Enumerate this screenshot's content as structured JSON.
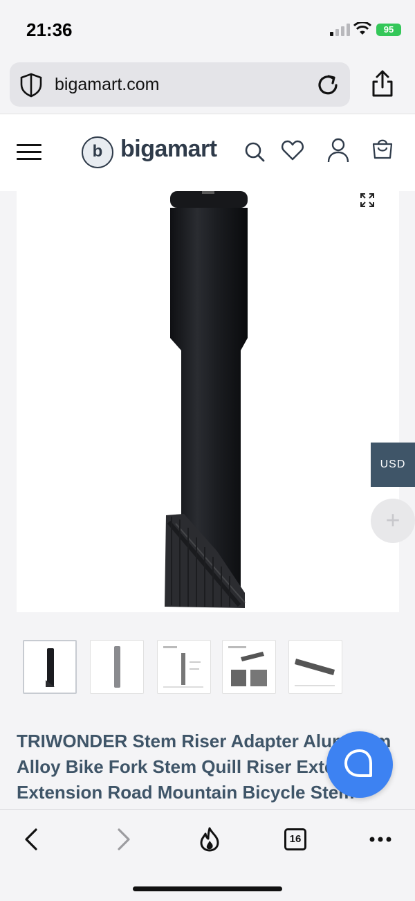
{
  "status_bar": {
    "time": "21:36",
    "battery": "95"
  },
  "browser": {
    "url": "bigamart.com",
    "tab_count": "16"
  },
  "site": {
    "logo_glyph": "b",
    "logo_text": "bigamart",
    "currency": "USD"
  },
  "product": {
    "title_lines": [
      "TRIWONDER Stem Riser Adapter Aluminum",
      "Alloy Bike Fork Stem Quill Riser Extender",
      "Extension Road Mountain Bicycle Stem"
    ],
    "thumbnail_count": 5
  },
  "colors": {
    "accent": "#3f5568",
    "chat": "#3d82f2",
    "battery": "#34c759"
  },
  "icons": {
    "header": [
      "search-icon",
      "heart-icon",
      "user-icon",
      "cart-icon"
    ],
    "toolbar": [
      "back-icon",
      "forward-icon",
      "flame-icon",
      "tabs-icon",
      "more-icon"
    ]
  }
}
